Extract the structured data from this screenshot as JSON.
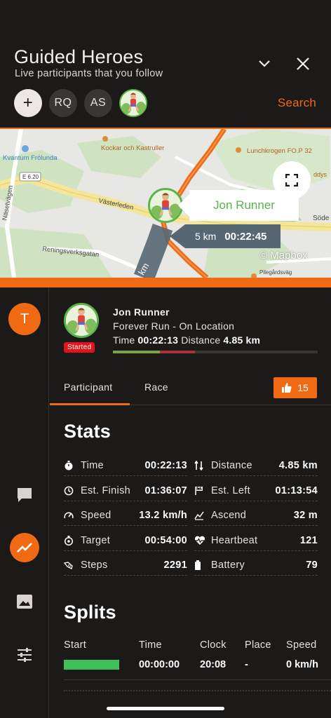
{
  "header": {
    "title": "Guided Heroes",
    "subtitle": "Live participants that you follow",
    "search_label": "Search",
    "avatars": [
      {
        "type": "add",
        "label": "+"
      },
      {
        "type": "initials",
        "label": "RQ"
      },
      {
        "type": "initials",
        "label": "AS"
      },
      {
        "type": "image",
        "icon": "runner-avatar"
      }
    ]
  },
  "map": {
    "labels": {
      "place1": "Kockar och Kastruller",
      "place2": "Kvantum Frölunda",
      "place3": "Lunchkrogen FO.P 32",
      "road_e": "E 6.20",
      "road1": "Västerleden",
      "road2": "Näsetvägen",
      "road3": "Reningsverksgatan",
      "road4": "Pilegårdsväg",
      "place4": "Söde",
      "place5": "ddys"
    },
    "runner_name": "Jon Runner",
    "callout_distance": "5 km",
    "callout_time": "00:22:45",
    "credit": "© Mapbox",
    "route_label": "km"
  },
  "rail": {
    "team_initial": "T"
  },
  "participant": {
    "status": "Started",
    "name": "Jon Runner",
    "race": "Forever Run - On Location",
    "time_label": "Time",
    "time_value": "00:22:13",
    "distance_label": "Distance",
    "distance_value": "4.85 km",
    "progress_fraction": 0.4,
    "progress_segments": [
      0.23,
      0.17
    ]
  },
  "tabs": {
    "participant": "Participant",
    "race": "Race",
    "likes": "15"
  },
  "stats": {
    "title": "Stats",
    "rows": [
      [
        {
          "icon": "stopwatch-icon",
          "label": "Time",
          "value": "00:22:13"
        },
        {
          "icon": "distance-icon",
          "label": "Distance",
          "value": "4.85 km"
        }
      ],
      [
        {
          "icon": "clock-icon",
          "label": "Est. Finish",
          "value": "01:36:07"
        },
        {
          "icon": "flag-icon",
          "label": "Est. Left",
          "value": "01:13:54"
        }
      ],
      [
        {
          "icon": "speedometer-icon",
          "label": "Speed",
          "value": "13.2 km/h"
        },
        {
          "icon": "ascend-icon",
          "label": "Ascend",
          "value": "32 m"
        }
      ],
      [
        {
          "icon": "target-icon",
          "label": "Target",
          "value": "00:54:00"
        },
        {
          "icon": "heartbeat-icon",
          "label": "Heartbeat",
          "value": "121"
        }
      ],
      [
        {
          "icon": "steps-icon",
          "label": "Steps",
          "value": "2291"
        },
        {
          "icon": "battery-icon",
          "label": "Battery",
          "value": "79"
        }
      ]
    ]
  },
  "splits": {
    "title": "Splits",
    "headers": [
      "Start",
      "Time",
      "Clock",
      "Place",
      "Speed"
    ],
    "rows": [
      {
        "time": "00:00:00",
        "clock": "20:08",
        "place": "-",
        "speed": "0 km/h"
      }
    ]
  },
  "colors": {
    "accent": "#f06a14",
    "runner_green": "#58b44a",
    "split_green": "#3fc15a",
    "status_red": "#e1131b"
  }
}
